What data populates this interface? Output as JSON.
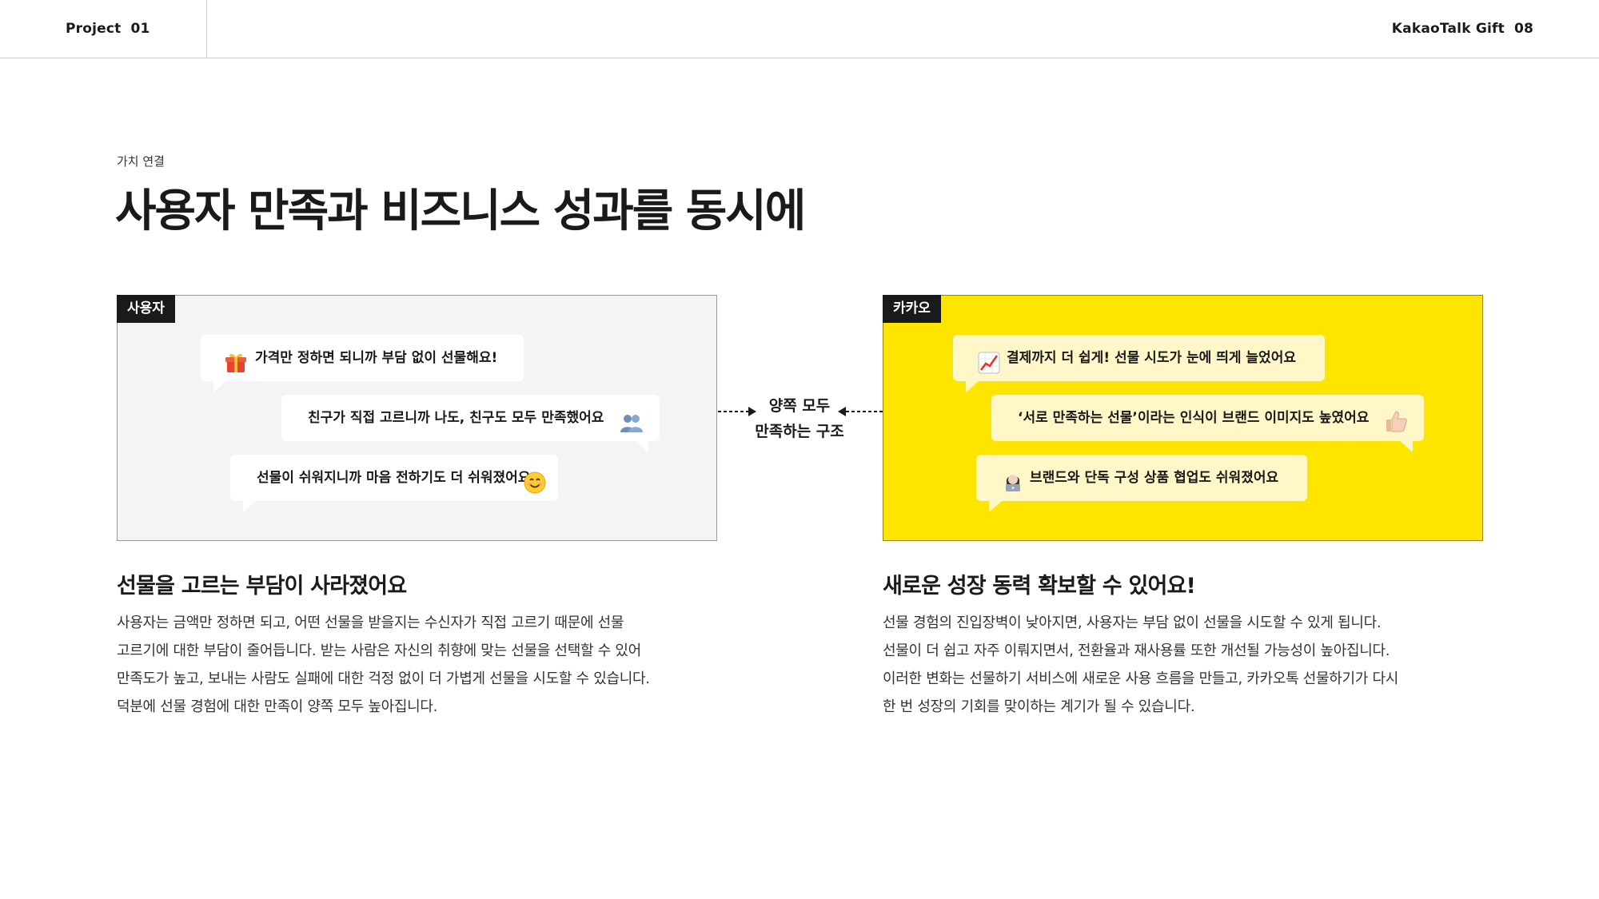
{
  "header": {
    "left_label": "Project",
    "left_number": "01",
    "right_label": "KakaoTalk Gift",
    "right_number": "08"
  },
  "eyebrow": "가치 연결",
  "title": "사용자 만족과 비즈니스 성과를 동시에",
  "user_panel": {
    "tag": "사용자",
    "bubbles": [
      {
        "text": "가격만 정하면 되니까 부담 없이 선물해요!",
        "icon": "gift-icon"
      },
      {
        "text": "친구가 직접 고르니까 나도, 친구도 모두 만족했어요",
        "icon": "people-icon"
      },
      {
        "text": "선물이 쉬워지니까 마음 전하기도 더 쉬워졌어요",
        "icon": "smile-icon"
      }
    ]
  },
  "kakao_panel": {
    "tag": "카카오",
    "bubbles": [
      {
        "text": "결제까지 더 쉽게! 선물 시도가 눈에 띄게 늘었어요",
        "icon": "chart-up-icon"
      },
      {
        "text": "‘서로 만족하는 선물’이라는 인식이 브랜드 이미지도 높였어요",
        "icon": "thumbs-up-icon"
      },
      {
        "text": "브랜드와 단독 구성 상품 협업도 쉬워졌어요",
        "icon": "technologist-icon"
      }
    ]
  },
  "center": {
    "line1": "양쪽 모두",
    "line2": "만족하는 구조"
  },
  "left_section": {
    "title": "선물을 고르는 부담이 사라졌어요",
    "lines": [
      "사용자는 금액만 정하면 되고, 어떤 선물을 받을지는 수신자가 직접 고르기 때문에 선물",
      "고르기에 대한 부담이 줄어듭니다. 받는 사람은 자신의 취향에 맞는 선물을 선택할 수 있어",
      "만족도가 높고, 보내는 사람도 실패에 대한 걱정 없이 더 가볍게 선물을 시도할 수 있습니다.",
      "덕분에 선물 경험에 대한 만족이 양쪽 모두 높아집니다."
    ]
  },
  "right_section": {
    "title": "새로운 성장 동력 확보할 수 있어요!",
    "lines": [
      "선물 경험의 진입장벽이 낮아지면, 사용자는 부담 없이 선물을 시도할 수 있게 됩니다.",
      "선물이 더 쉽고 자주 이뤄지면서, 전환율과 재사용률 또한 개선될 가능성이 높아집니다.",
      "이러한 변화는 선물하기 서비스에 새로운 사용 흐름을 만들고, 카카오톡 선물하기가 다시",
      "한 번 성장의 기회를 맞이하는 계기가 될 수 있습니다."
    ]
  },
  "colors": {
    "kakao_yellow": "#fee500",
    "user_panel_bg": "#f4f4f4",
    "tag_bg": "#1a1a1a"
  }
}
